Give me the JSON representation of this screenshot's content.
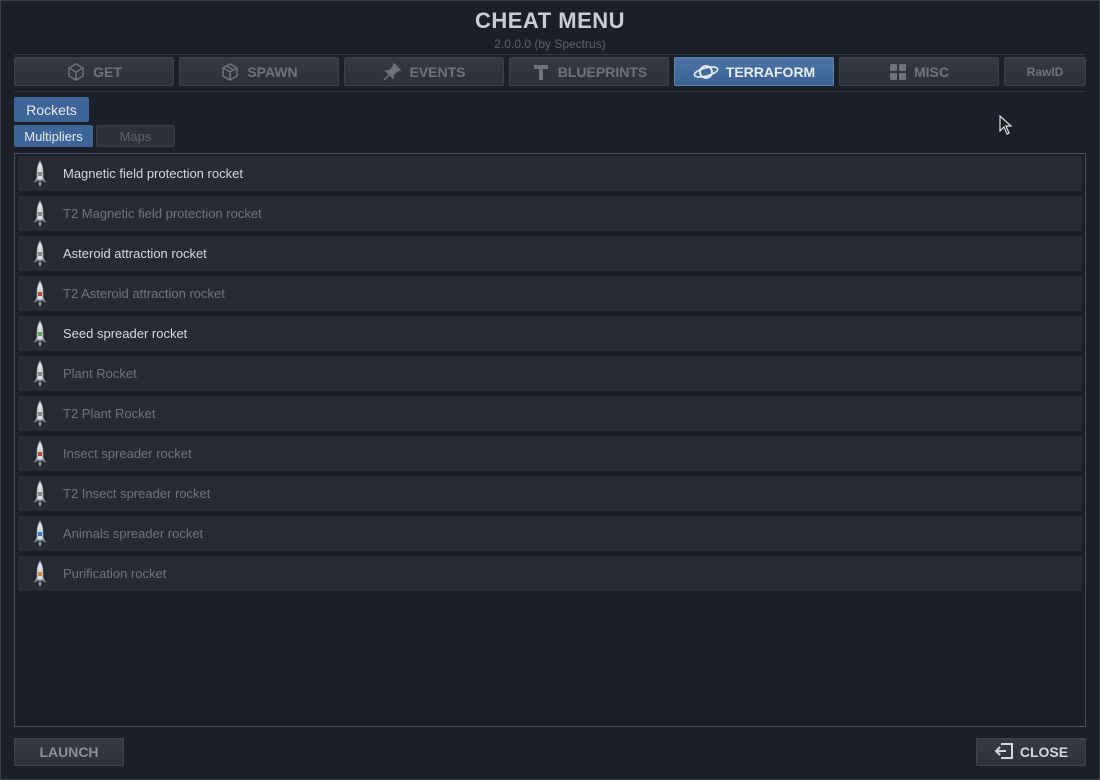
{
  "header": {
    "title": "CHEAT MENU",
    "subtitle": "2.0.0.0  (by Spectrus)"
  },
  "tabs": [
    {
      "label": "GET",
      "icon": "cube-icon",
      "active": false
    },
    {
      "label": "SPAWN",
      "icon": "box-icon",
      "active": false
    },
    {
      "label": "EVENTS",
      "icon": "pin-icon",
      "active": false
    },
    {
      "label": "BLUEPRINTS",
      "icon": "hammer-icon",
      "active": false
    },
    {
      "label": "TERRAFORM",
      "icon": "planet-icon",
      "active": true
    },
    {
      "label": "MISC",
      "icon": "grid-icon",
      "active": false
    },
    {
      "label": "RawID",
      "icon": "",
      "active": false
    }
  ],
  "category": {
    "label": "Rockets"
  },
  "subtabs": [
    {
      "label": "Multipliers",
      "active": true
    },
    {
      "label": "Maps",
      "active": false
    }
  ],
  "items": [
    {
      "label": "Magnetic field protection rocket",
      "enabled": true,
      "accent": "#888888"
    },
    {
      "label": "T2 Magnetic field protection rocket",
      "enabled": false,
      "accent": "#888888"
    },
    {
      "label": "Asteroid attraction rocket",
      "enabled": true,
      "accent": "#888888"
    },
    {
      "label": "T2 Asteroid attraction rocket",
      "enabled": false,
      "accent": "#c0483a"
    },
    {
      "label": "Seed spreader rocket",
      "enabled": true,
      "accent": "#5aa85a"
    },
    {
      "label": "Plant Rocket",
      "enabled": false,
      "accent": "#888888"
    },
    {
      "label": "T2 Plant Rocket",
      "enabled": false,
      "accent": "#888888"
    },
    {
      "label": "Insect spreader rocket",
      "enabled": false,
      "accent": "#c0483a"
    },
    {
      "label": "T2 Insect spreader rocket",
      "enabled": false,
      "accent": "#888888"
    },
    {
      "label": "Animals spreader rocket",
      "enabled": false,
      "accent": "#3a7ac0"
    },
    {
      "label": "Purification rocket",
      "enabled": false,
      "accent": "#d08a3a"
    }
  ],
  "footer": {
    "launch_label": "LAUNCH",
    "close_label": "CLOSE"
  },
  "colors": {
    "accent": "#3d6597",
    "background": "#1c1f27"
  }
}
